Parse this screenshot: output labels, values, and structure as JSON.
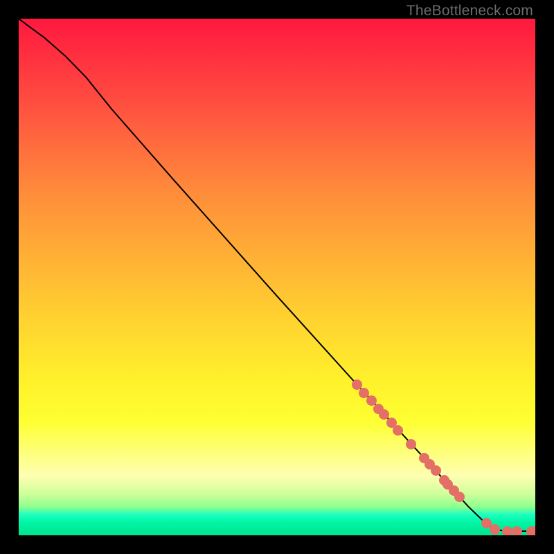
{
  "attribution": "TheBottleneck.com",
  "colors": {
    "dot": "#e36f67",
    "curve": "#000000",
    "frame": "#000000"
  },
  "chart_data": {
    "type": "line",
    "title": "",
    "xlabel": "",
    "ylabel": "",
    "xlim": [
      0,
      100
    ],
    "ylim": [
      0,
      100
    ],
    "curve": [
      {
        "x": 0.0,
        "y": 100.0
      },
      {
        "x": 2.0,
        "y": 98.5
      },
      {
        "x": 5.0,
        "y": 96.3
      },
      {
        "x": 9.0,
        "y": 92.8
      },
      {
        "x": 13.0,
        "y": 88.7
      },
      {
        "x": 18.0,
        "y": 82.5
      },
      {
        "x": 30.0,
        "y": 68.8
      },
      {
        "x": 50.0,
        "y": 46.3
      },
      {
        "x": 65.0,
        "y": 29.7
      },
      {
        "x": 80.0,
        "y": 13.3
      },
      {
        "x": 87.0,
        "y": 5.6
      },
      {
        "x": 90.0,
        "y": 2.7
      },
      {
        "x": 92.0,
        "y": 1.3
      },
      {
        "x": 94.0,
        "y": 0.8
      },
      {
        "x": 100.0,
        "y": 0.8
      }
    ],
    "scatter": [
      {
        "x": 65.5,
        "y": 29.2
      },
      {
        "x": 66.8,
        "y": 27.6
      },
      {
        "x": 68.3,
        "y": 26.1
      },
      {
        "x": 69.6,
        "y": 24.5
      },
      {
        "x": 70.7,
        "y": 23.4
      },
      {
        "x": 72.2,
        "y": 21.8
      },
      {
        "x": 73.4,
        "y": 20.3
      },
      {
        "x": 76.0,
        "y": 17.6
      },
      {
        "x": 78.5,
        "y": 14.9
      },
      {
        "x": 79.6,
        "y": 13.8
      },
      {
        "x": 80.7,
        "y": 12.5
      },
      {
        "x": 82.4,
        "y": 10.7
      },
      {
        "x": 83.1,
        "y": 9.8
      },
      {
        "x": 84.2,
        "y": 8.6
      },
      {
        "x": 85.3,
        "y": 7.5
      },
      {
        "x": 90.5,
        "y": 2.3
      },
      {
        "x": 92.1,
        "y": 1.2
      },
      {
        "x": 94.6,
        "y": 0.8
      },
      {
        "x": 96.5,
        "y": 0.8
      },
      {
        "x": 99.3,
        "y": 0.8
      },
      {
        "x": 100.0,
        "y": 0.8
      }
    ]
  }
}
